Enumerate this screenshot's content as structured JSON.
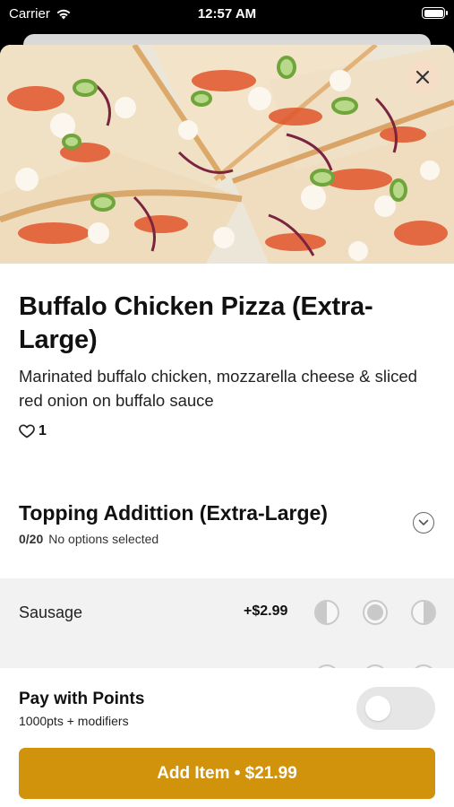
{
  "status_bar": {
    "carrier": "Carrier",
    "time": "12:57 AM"
  },
  "item": {
    "title": "Buffalo Chicken Pizza (Extra-Large)",
    "description": "Marinated buffalo chicken, mozzarella cheese & sliced red onion on buffalo sauce",
    "likes": "1"
  },
  "modifier_group": {
    "title": "Topping Addittion (Extra-Large)",
    "count": "0/20",
    "status": "No options selected"
  },
  "options": [
    {
      "name": "Sausage",
      "price": "+$2.99"
    }
  ],
  "footer": {
    "pay_title": "Pay with Points",
    "pay_subtitle": "1000pts + modifiers",
    "pay_toggle_on": false,
    "add_button": "Add Item • $21.99"
  },
  "colors": {
    "accent": "#d2930c",
    "option_background": "#f2f2f2"
  },
  "icons": {
    "close": "close-icon",
    "heart": "heart-icon",
    "chevron": "chevron-down-icon",
    "wifi": "wifi-icon",
    "battery": "battery-icon"
  }
}
